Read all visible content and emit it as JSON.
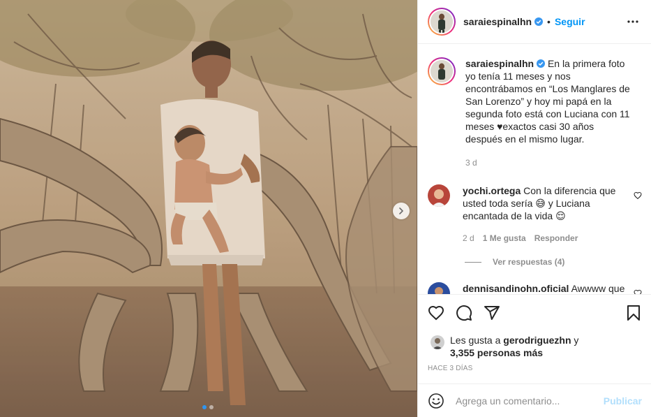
{
  "post": {
    "username": "saraiespinalhn",
    "follow_label": "Seguir",
    "separator": "•",
    "caption": "En la primera foto yo tenía 11 meses y nos encontrábamos en “Los Manglares de San Lorenzo” y hoy mi papá en la segunda foto está con Luciana con 11 meses ♥exactos casi 30 años después en el mismo lugar.",
    "caption_time": "3 d"
  },
  "comments": [
    {
      "username": "yochi.ortega",
      "text": "Con la diferencia que usted toda sería 😅 y Luciana encantada de la vida 😌",
      "time": "2 d",
      "likes": "1 Me gusta",
      "reply_label": "Responder",
      "view_replies": "Ver respuestas (4)"
    },
    {
      "username": "dennisandinohn.oficial",
      "text": "Awwww que lindos"
    }
  ],
  "likes": {
    "prefix": "Les gusta a",
    "user": "gerodriguezhn",
    "conj": "y",
    "others": "3,355 personas más"
  },
  "post_date": "HACE 3 DÍAS",
  "add_comment": {
    "placeholder": "Agrega un comentario...",
    "publish_label": "Publicar"
  },
  "carousel": {
    "current": 1,
    "total": 2
  },
  "colors": {
    "accent": "#0095f6",
    "publish_disabled": "#b2dffc",
    "muted": "#8e8e8e"
  }
}
